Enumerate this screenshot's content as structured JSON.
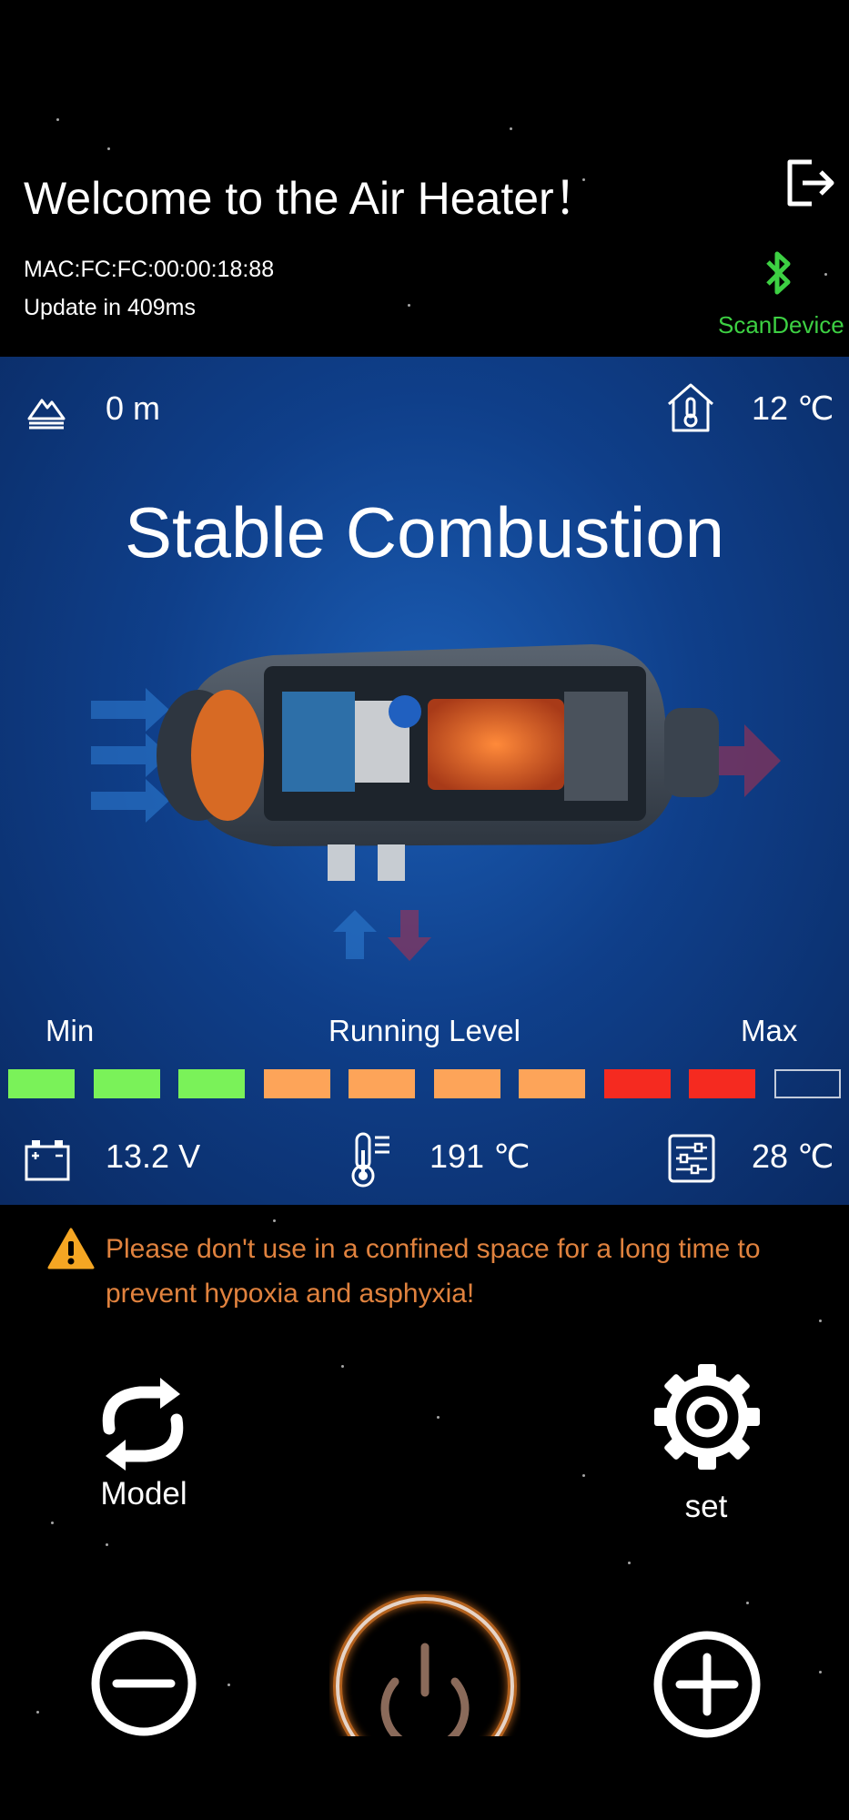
{
  "header": {
    "title": "Welcome to the Air Heater！",
    "mac": "MAC:FC:FC:00:00:18:88",
    "update": "Update in 409ms",
    "scan_label": "ScanDevice"
  },
  "status_bar": {
    "altitude": "0 m",
    "indoor_temp": "12 ℃"
  },
  "main": {
    "status": "Stable Combustion"
  },
  "running_level": {
    "min_label": "Min",
    "title": "Running Level",
    "max_label": "Max",
    "level": 9,
    "total": 10,
    "segments": [
      {
        "color": "#7af259",
        "active": true
      },
      {
        "color": "#7af259",
        "active": true
      },
      {
        "color": "#7af259",
        "active": true
      },
      {
        "color": "#fda459",
        "active": true
      },
      {
        "color": "#fda459",
        "active": true
      },
      {
        "color": "#fda459",
        "active": true
      },
      {
        "color": "#fda459",
        "active": true
      },
      {
        "color": "#f52a20",
        "active": true
      },
      {
        "color": "#f52a20",
        "active": true
      },
      {
        "color": "transparent",
        "active": false
      }
    ]
  },
  "readings": {
    "voltage": "13.2 V",
    "case_temp": "191 ℃",
    "set_temp": "28 ℃"
  },
  "warning": {
    "line1": "Please don't use in a confined space for a long time to",
    "line2": "prevent hypoxia and asphyxia!"
  },
  "controls": {
    "model_label": "Model",
    "set_label": "set"
  },
  "colors": {
    "accent_green": "#3dd043",
    "warning_orange": "#e0823e",
    "panel_blue": "#0f3f8a",
    "power_glow": "#ff8a2a"
  },
  "icons": {
    "logout": "logout-icon",
    "bluetooth": "bluetooth-icon",
    "altitude": "mountain-icon",
    "indoor": "house-thermometer-icon",
    "battery": "battery-icon",
    "thermometer": "thermometer-icon",
    "settings_sliders": "sliders-icon",
    "warning": "warning-icon",
    "model": "refresh-icon",
    "set": "gear-icon",
    "minus": "minus-icon",
    "plus": "plus-icon",
    "power": "power-icon"
  }
}
